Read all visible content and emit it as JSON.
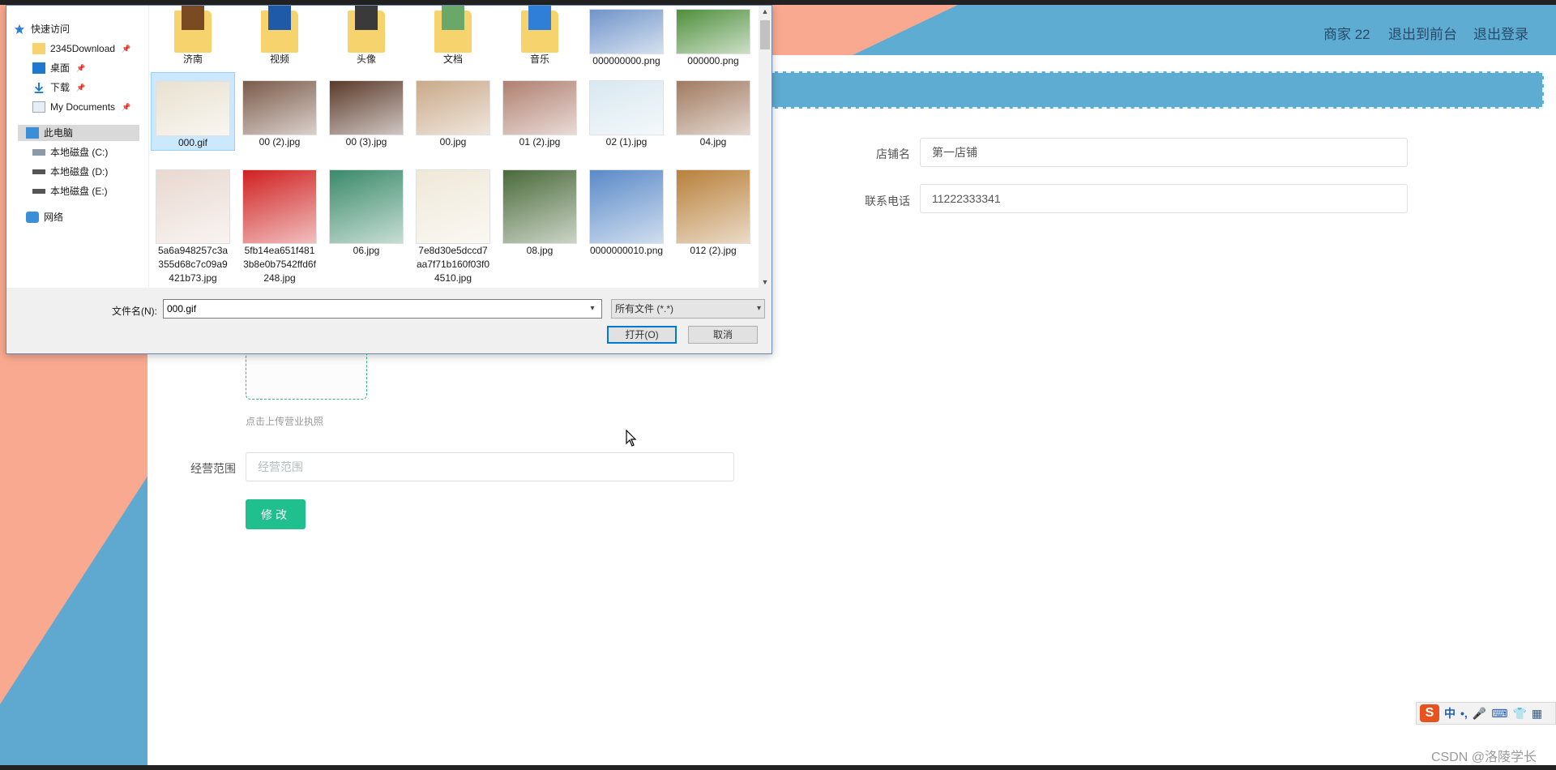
{
  "header": {
    "user_label": "商家 22",
    "front_label": "退出到前台",
    "logout_label": "退出登录"
  },
  "form": {
    "shop_name_label": "店铺名",
    "shop_name_value": "第一店铺",
    "phone_label": "联系电话",
    "phone_value": "11222333341",
    "upload_hint": "点击上传营业执照",
    "scope_label": "经营范围",
    "scope_placeholder": "经营范围",
    "submit_label": "修改"
  },
  "dialog": {
    "nav": {
      "quick_access": "快速访问",
      "items": [
        "2345Download",
        "桌面",
        "下载",
        "My Documents"
      ],
      "this_pc": "此电脑",
      "drives": [
        "本地磁盘 (C:)",
        "本地磁盘 (D:)",
        "本地磁盘 (E:)"
      ],
      "network": "网络"
    },
    "files": [
      {
        "name": "济南",
        "kind": "folder",
        "color": "#7a4a22"
      },
      {
        "name": "视频",
        "kind": "folder",
        "color": "#1e5aa8"
      },
      {
        "name": "头像",
        "kind": "folder",
        "color": "#3a3a3a"
      },
      {
        "name": "文档",
        "kind": "folder",
        "color": "#6aa86a"
      },
      {
        "name": "音乐",
        "kind": "folder",
        "color": "#2f7ed8"
      },
      {
        "name": "000000000.png",
        "kind": "image",
        "color": "#6f94c9"
      },
      {
        "name": "000000.png",
        "kind": "image",
        "color": "#4e8f3c"
      },
      {
        "name": "000.gif",
        "kind": "image",
        "color": "#e9e1d0",
        "selected": true
      },
      {
        "name": "00 (2).jpg",
        "kind": "image",
        "color": "#7b5b4a"
      },
      {
        "name": "00 (3).jpg",
        "kind": "image",
        "color": "#5a3a2a"
      },
      {
        "name": "00.jpg",
        "kind": "image",
        "color": "#c9a989"
      },
      {
        "name": "01 (2).jpg",
        "kind": "image",
        "color": "#b08070"
      },
      {
        "name": "02 (1).jpg",
        "kind": "image",
        "color": "#d8e8f0"
      },
      {
        "name": "04.jpg",
        "kind": "image",
        "color": "#a07a60"
      },
      {
        "name": "5a6a948257c3a355d68c7c09a9421b73.jpg",
        "kind": "image",
        "color": "#e8d8d0"
      },
      {
        "name": "5fb14ea651f4813b8e0b7542ffd6f248.jpg",
        "kind": "image",
        "color": "#d02020"
      },
      {
        "name": "06.jpg",
        "kind": "image",
        "color": "#3a8a6a"
      },
      {
        "name": "7e8d30e5dccd7aa7f71b160f03f04510.jpg",
        "kind": "image",
        "color": "#efe8d8"
      },
      {
        "name": "08.jpg",
        "kind": "image",
        "color": "#4a6a3a"
      },
      {
        "name": "0000000010.png",
        "kind": "image",
        "color": "#5a8ac8"
      },
      {
        "name": "012 (2).jpg",
        "kind": "image",
        "color": "#b8803a"
      }
    ],
    "filename_label": "文件名(N):",
    "filename_value": "000.gif",
    "filetype_value": "所有文件 (*.*)",
    "open_label": "打开(O)",
    "cancel_label": "取消"
  },
  "ime": {
    "items": [
      "中",
      "•,",
      "🎤",
      "⌨",
      "👕",
      "▦"
    ]
  },
  "watermark": "CSDN @洛陵学长"
}
